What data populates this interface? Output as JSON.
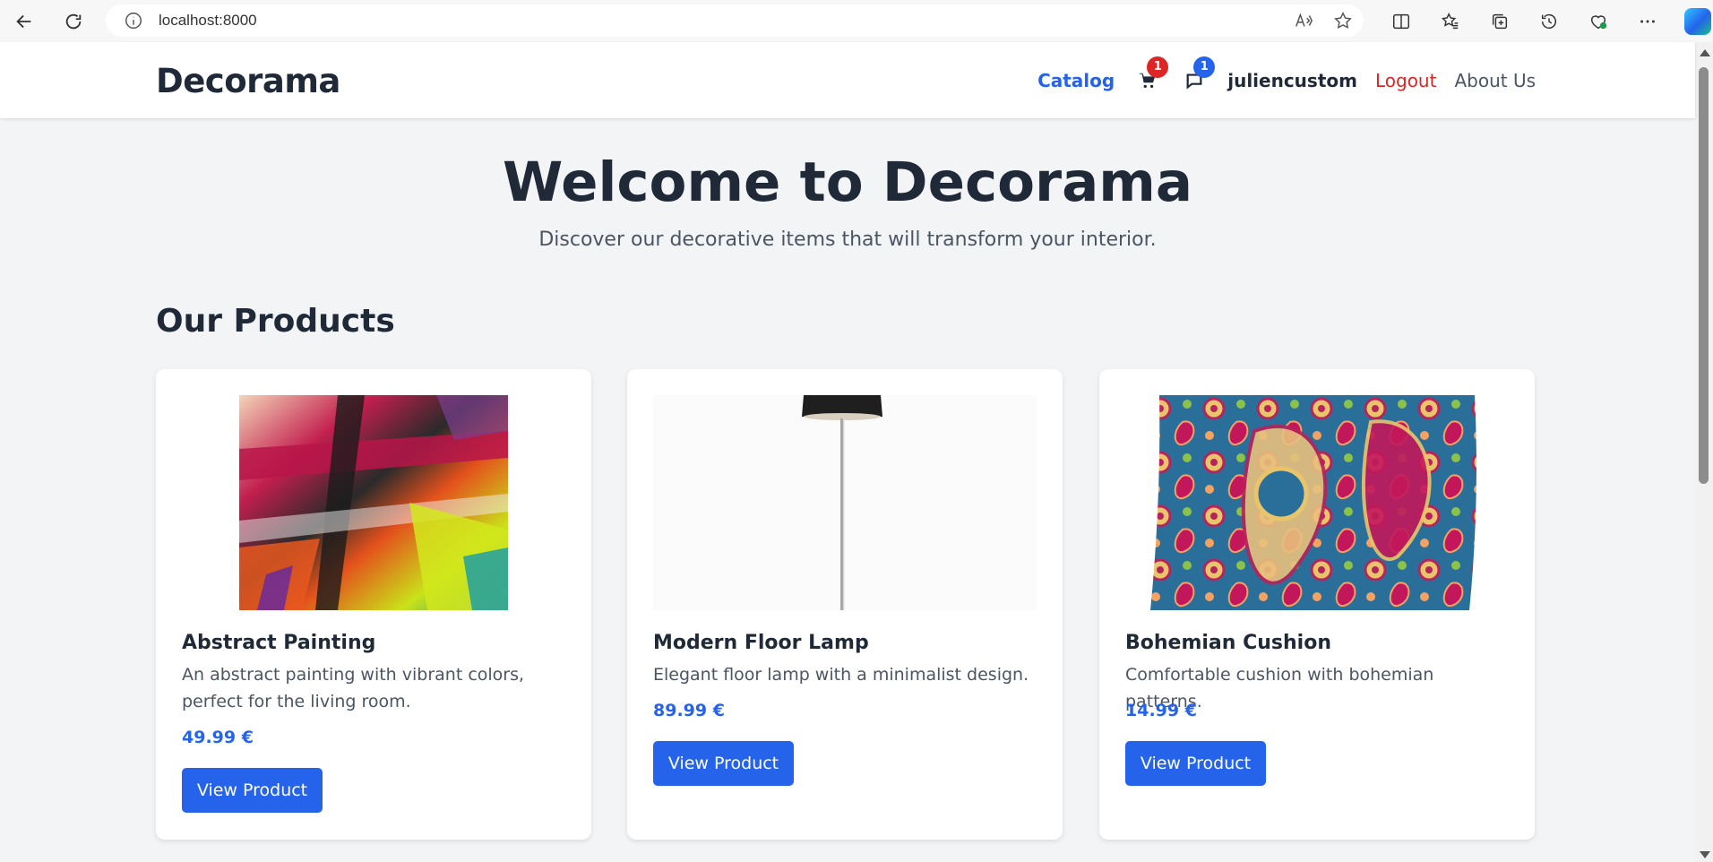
{
  "browser": {
    "url": "localhost:8000"
  },
  "header": {
    "logo": "Decorama",
    "nav": {
      "catalog": "Catalog",
      "cart_count": "1",
      "messages_count": "1",
      "username": "juliencustom",
      "logout": "Logout",
      "about": "About Us"
    }
  },
  "hero": {
    "title": "Welcome to Decorama",
    "subtitle": "Discover our decorative items that will transform your interior."
  },
  "products_section": {
    "title": "Our Products",
    "items": [
      {
        "name": "Abstract Painting",
        "description": "An abstract painting with vibrant colors, perfect for the living room.",
        "price": "49.99 €",
        "button": "View Product"
      },
      {
        "name": "Modern Floor Lamp",
        "description": "Elegant floor lamp with a minimalist design.",
        "price": "89.99 €",
        "button": "View Product"
      },
      {
        "name": "Bohemian Cushion",
        "description": "Comfortable cushion with bohemian patterns.",
        "price": "14.99 €",
        "button": "View Product"
      }
    ]
  },
  "colors": {
    "accent": "#2563eb",
    "danger": "#dc2626",
    "text": "#1f2937",
    "muted": "#4b5563",
    "background": "#f3f4f6"
  }
}
